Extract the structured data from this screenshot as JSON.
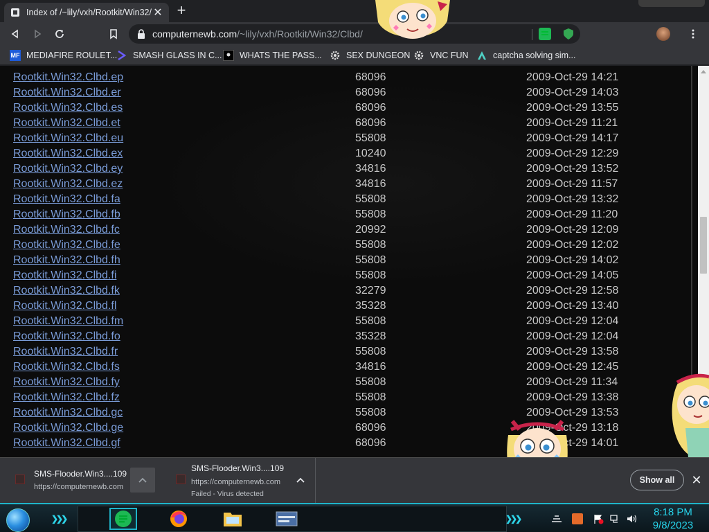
{
  "browser": {
    "tab": {
      "title": "Index of /~lily/vxh/Rootkit/Win32/",
      "close_glyph": "✕"
    },
    "new_tab_glyph": "+",
    "address": {
      "host": "computernewb.com",
      "path": "/~lily/vxh/Rootkit/Win32/Clbd/"
    }
  },
  "bookmarks": [
    {
      "label": "MEDIAFIRE ROULET...",
      "icon": "mediafire-icon",
      "icon_text": "MF"
    },
    {
      "label": "SMASH GLASS IN C...",
      "icon": "chevron-bookmark-icon"
    },
    {
      "label": "WHATS THE PASS...",
      "icon": "dark-square-icon"
    },
    {
      "label": "SEX DUNGEON",
      "icon": "gear-bookmark-icon"
    },
    {
      "label": "VNC FUN",
      "icon": "gear-bookmark-icon"
    },
    {
      "label": "captcha solving sim...",
      "icon": "triangle-bookmark-icon"
    }
  ],
  "listing": [
    {
      "name": "Rootkit.Win32.Clbd.ep",
      "size": "68096",
      "date": "2009-Oct-29 14:21"
    },
    {
      "name": "Rootkit.Win32.Clbd.er",
      "size": "68096",
      "date": "2009-Oct-29 14:03"
    },
    {
      "name": "Rootkit.Win32.Clbd.es",
      "size": "68096",
      "date": "2009-Oct-29 13:55"
    },
    {
      "name": "Rootkit.Win32.Clbd.et",
      "size": "68096",
      "date": "2009-Oct-29 11:21"
    },
    {
      "name": "Rootkit.Win32.Clbd.eu",
      "size": "55808",
      "date": "2009-Oct-29 14:17"
    },
    {
      "name": "Rootkit.Win32.Clbd.ex",
      "size": "10240",
      "date": "2009-Oct-29 12:29"
    },
    {
      "name": "Rootkit.Win32.Clbd.ey",
      "size": "34816",
      "date": "2009-Oct-29 13:52"
    },
    {
      "name": "Rootkit.Win32.Clbd.ez",
      "size": "34816",
      "date": "2009-Oct-29 11:57"
    },
    {
      "name": "Rootkit.Win32.Clbd.fa",
      "size": "55808",
      "date": "2009-Oct-29 13:32"
    },
    {
      "name": "Rootkit.Win32.Clbd.fb",
      "size": "55808",
      "date": "2009-Oct-29 11:20"
    },
    {
      "name": "Rootkit.Win32.Clbd.fc",
      "size": "20992",
      "date": "2009-Oct-29 12:09"
    },
    {
      "name": "Rootkit.Win32.Clbd.fe",
      "size": "55808",
      "date": "2009-Oct-29 12:02"
    },
    {
      "name": "Rootkit.Win32.Clbd.fh",
      "size": "55808",
      "date": "2009-Oct-29 14:02"
    },
    {
      "name": "Rootkit.Win32.Clbd.fi",
      "size": "55808",
      "date": "2009-Oct-29 14:05"
    },
    {
      "name": "Rootkit.Win32.Clbd.fk",
      "size": "32279",
      "date": "2009-Oct-29 12:58"
    },
    {
      "name": "Rootkit.Win32.Clbd.fl",
      "size": "35328",
      "date": "2009-Oct-29 13:40"
    },
    {
      "name": "Rootkit.Win32.Clbd.fm",
      "size": "55808",
      "date": "2009-Oct-29 12:04"
    },
    {
      "name": "Rootkit.Win32.Clbd.fo",
      "size": "35328",
      "date": "2009-Oct-29 12:04"
    },
    {
      "name": "Rootkit.Win32.Clbd.fr",
      "size": "55808",
      "date": "2009-Oct-29 13:58"
    },
    {
      "name": "Rootkit.Win32.Clbd.fs",
      "size": "34816",
      "date": "2009-Oct-29 12:45"
    },
    {
      "name": "Rootkit.Win32.Clbd.fy",
      "size": "55808",
      "date": "2009-Oct-29 11:34"
    },
    {
      "name": "Rootkit.Win32.Clbd.fz",
      "size": "55808",
      "date": "2009-Oct-29 13:38"
    },
    {
      "name": "Rootkit.Win32.Clbd.gc",
      "size": "55808",
      "date": "2009-Oct-29 13:53"
    },
    {
      "name": "Rootkit.Win32.Clbd.ge",
      "size": "68096",
      "date": "2009-Oct-29 13:18"
    },
    {
      "name": "Rootkit.Win32.Clbd.gf",
      "size": "68096",
      "date": "2009-Oct-29 14:01"
    }
  ],
  "downloads": {
    "items": [
      {
        "name": "SMS-Flooder.Win3....109",
        "line2": "https://computernewb.com",
        "line3": ""
      },
      {
        "name": "SMS-Flooder.Win3....109",
        "line2": "https://computernewb.com",
        "line3": "Failed - Virus detected"
      }
    ],
    "show_all": "Show all",
    "close_glyph": "✕"
  },
  "taskbar": {
    "time": "8:18 PM",
    "date": "9/8/2023",
    "apps": [
      "notes-app-icon",
      "firefox-icon",
      "file-explorer-icon",
      "window-app-icon"
    ]
  },
  "colors": {
    "link": "#7a9cd8",
    "text": "#c8c8c8",
    "page_bg": "#0c0c0c",
    "chrome_bg": "#35363a",
    "taskbar_accent": "#1fb4c9"
  }
}
